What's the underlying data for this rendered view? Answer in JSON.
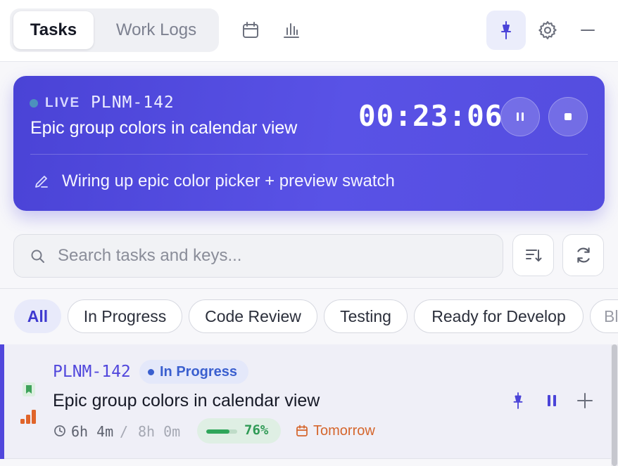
{
  "header": {
    "tabs": [
      {
        "label": "Tasks",
        "active": true
      },
      {
        "label": "Work Logs",
        "active": false
      }
    ],
    "icons": [
      "calendar-icon",
      "bar-chart-icon",
      "pin-icon",
      "gear-icon",
      "minimize-icon"
    ]
  },
  "live": {
    "status": "LIVE",
    "key": "PLNM-142",
    "title": "Epic group colors in calendar view",
    "timer": "00:23:06",
    "note": "Wiring up epic color picker + preview swatch"
  },
  "search": {
    "placeholder": "Search tasks and keys..."
  },
  "filters": [
    {
      "label": "All",
      "active": true
    },
    {
      "label": "In Progress",
      "active": false
    },
    {
      "label": "Code Review",
      "active": false
    },
    {
      "label": "Testing",
      "active": false
    },
    {
      "label": "Ready for Develop",
      "active": false
    },
    {
      "label": "Bl",
      "active": false
    }
  ],
  "tasks": [
    {
      "key": "PLNM-142",
      "status": "In Progress",
      "title": "Epic group colors in calendar view",
      "time_spent": "6h 4m",
      "time_separator": "/",
      "time_estimate": "8h 0m",
      "progress": 0.76,
      "progress_label": "76%",
      "due": "Tomorrow"
    }
  ],
  "colors": {
    "accent": "#5147dc",
    "live_card": "#4f48de",
    "status_blue": "#3a5fcf",
    "progress_green": "#2fa65a",
    "due_orange": "#d5662d",
    "priority_orange": "#e0642a",
    "bookmark_green": "#3fa35a"
  }
}
